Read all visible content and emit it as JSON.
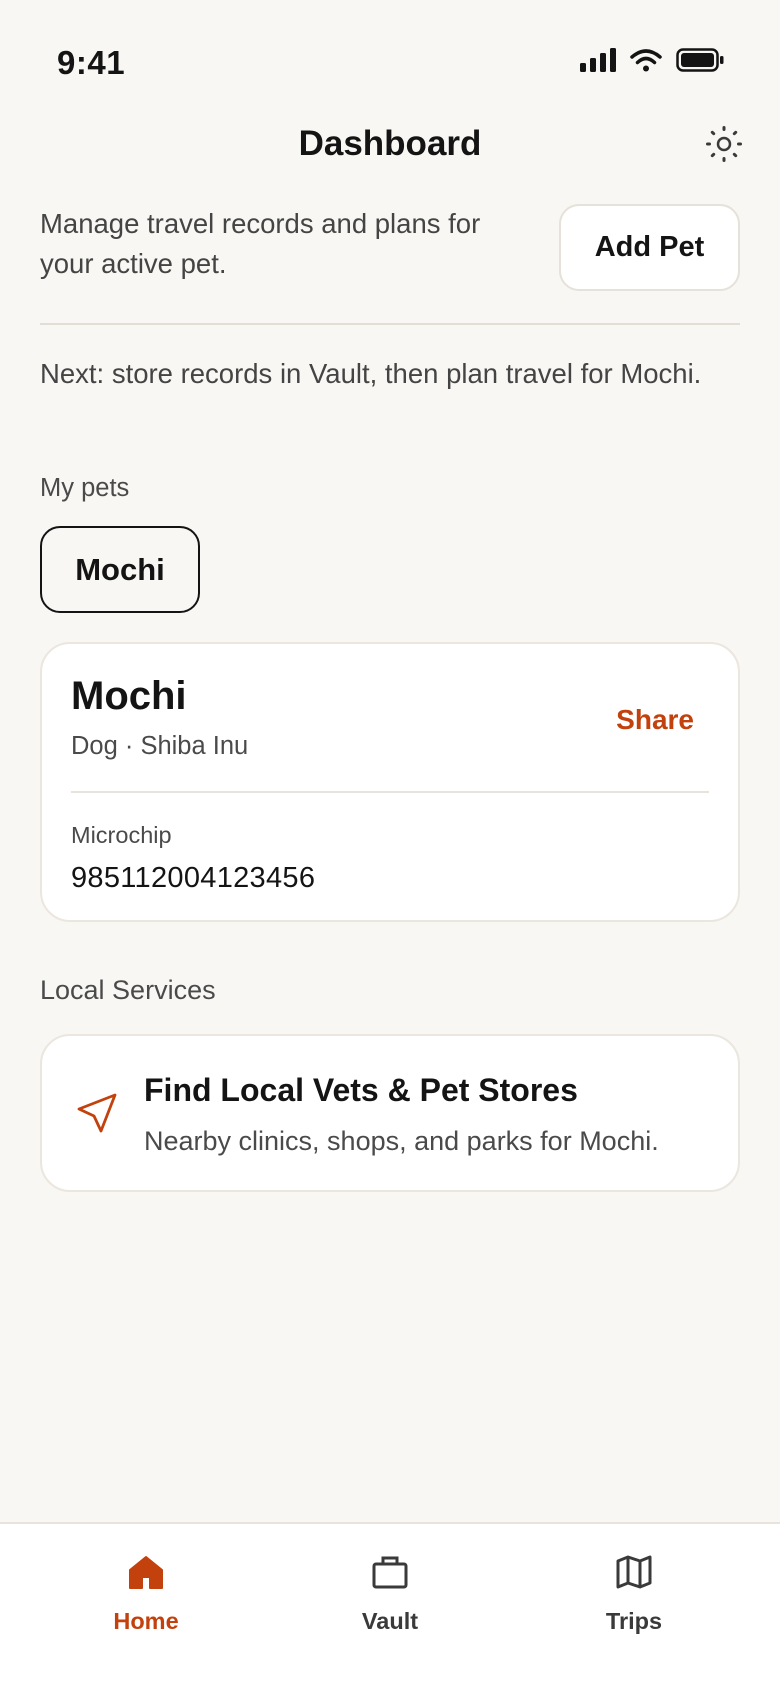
{
  "status_bar": {
    "time": "9:41"
  },
  "header": {
    "title": "Dashboard",
    "settings_icon": "gear-icon"
  },
  "intro": {
    "text": "Manage travel records and plans for your active pet.",
    "add_pet_label": "Add Pet"
  },
  "next_step": {
    "text": "Next: store records in Vault, then plan travel for Mochi."
  },
  "my_pets": {
    "label": "My pets",
    "pets": [
      {
        "name": "Mochi",
        "selected": true
      }
    ]
  },
  "pet_card": {
    "name": "Mochi",
    "breed": "Dog · Shiba Inu",
    "share_label": "Share",
    "microchip_label": "Microchip",
    "microchip_value": "985112004123456"
  },
  "local_services": {
    "label": "Local Services",
    "card": {
      "icon": "navigation-arrow-icon",
      "title": "Find Local Vets & Pet Stores",
      "subtitle": "Nearby clinics, shops, and parks for Mochi."
    }
  },
  "tab_bar": {
    "items": [
      {
        "label": "Home",
        "icon": "home-icon",
        "active": true
      },
      {
        "label": "Vault",
        "icon": "briefcase-icon",
        "active": false
      },
      {
        "label": "Trips",
        "icon": "map-icon",
        "active": false
      }
    ]
  },
  "colors": {
    "accent": "#c2410c",
    "background": "#f8f7f4",
    "text": "#141414",
    "muted": "#4a4a4a",
    "inactive_tab": "#3a3a3a"
  }
}
